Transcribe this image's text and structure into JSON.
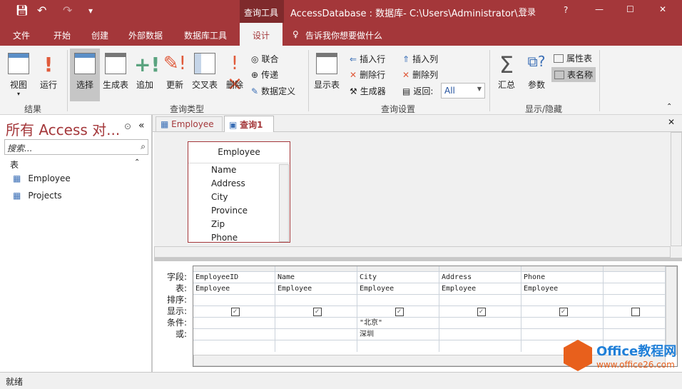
{
  "titlebar": {
    "contextual_tab": "查询工具",
    "title": "AccessDatabase : 数据库- C:\\Users\\Administrator\\...",
    "login": "登录",
    "help": "?",
    "minimize": "—",
    "maximize": "☐",
    "close": "✕",
    "save_icon": "save-icon",
    "undo": "↶",
    "redo": "↷",
    "customize": "▾"
  },
  "tabs": [
    {
      "label": "文件"
    },
    {
      "label": "开始"
    },
    {
      "label": "创建"
    },
    {
      "label": "外部数据"
    },
    {
      "label": "数据库工具"
    },
    {
      "label": "设计",
      "selected": true
    }
  ],
  "tell_me": "告诉我你想要做什么",
  "ribbon": {
    "results": {
      "label": "结果",
      "view": "视图",
      "run": "运行"
    },
    "query_type": {
      "label": "查询类型",
      "select": "选择",
      "make_table": "生成表",
      "append": "追加",
      "update": "更新",
      "crosstab": "交叉表",
      "delete": "删除",
      "union": "联合",
      "pass_through": "传递",
      "data_definition": "数据定义"
    },
    "query_setup": {
      "label": "查询设置",
      "show_table": "显示表",
      "insert_rows": "插入行",
      "delete_rows": "删除行",
      "builder": "生成器",
      "insert_columns": "插入列",
      "delete_columns": "删除列",
      "return_label": "返回:",
      "return_value": "All"
    },
    "show_hide": {
      "label": "显示/隐藏",
      "totals": "汇总",
      "parameters": "参数",
      "property_sheet": "属性表",
      "table_names": "表名称"
    }
  },
  "nav": {
    "title": "所有 Access 对...",
    "search_placeholder": "搜索...",
    "section": "表",
    "items": [
      {
        "label": "Employee"
      },
      {
        "label": "Projects"
      }
    ]
  },
  "doc_tabs": [
    {
      "label": "Employee"
    },
    {
      "label": "查询1",
      "selected": true
    }
  ],
  "table_box": {
    "title": "Employee",
    "fields": [
      "Name",
      "Address",
      "City",
      "Province",
      "Zip",
      "Phone"
    ]
  },
  "grid": {
    "row_labels": [
      "字段:",
      "表:",
      "排序:",
      "显示:",
      "条件:",
      "或:"
    ],
    "columns": [
      {
        "field": "EmployeeID",
        "table": "Employee",
        "sort": "",
        "show": true,
        "criteria": "",
        "or": ""
      },
      {
        "field": "Name",
        "table": "Employee",
        "sort": "",
        "show": true,
        "criteria": "",
        "or": ""
      },
      {
        "field": "City",
        "table": "Employee",
        "sort": "",
        "show": true,
        "criteria": "\"北京\"",
        "or": "深圳"
      },
      {
        "field": "Address",
        "table": "Employee",
        "sort": "",
        "show": true,
        "criteria": "",
        "or": ""
      },
      {
        "field": "Phone",
        "table": "Employee",
        "sort": "",
        "show": true,
        "criteria": "",
        "or": ""
      },
      {
        "field": "",
        "table": "",
        "sort": "",
        "show": false,
        "criteria": "",
        "or": ""
      }
    ]
  },
  "status": {
    "text": "就绪"
  },
  "watermark": {
    "line1": "Office教程网",
    "line2": "www.office26.com"
  },
  "colors": {
    "accent": "#a4373a"
  }
}
